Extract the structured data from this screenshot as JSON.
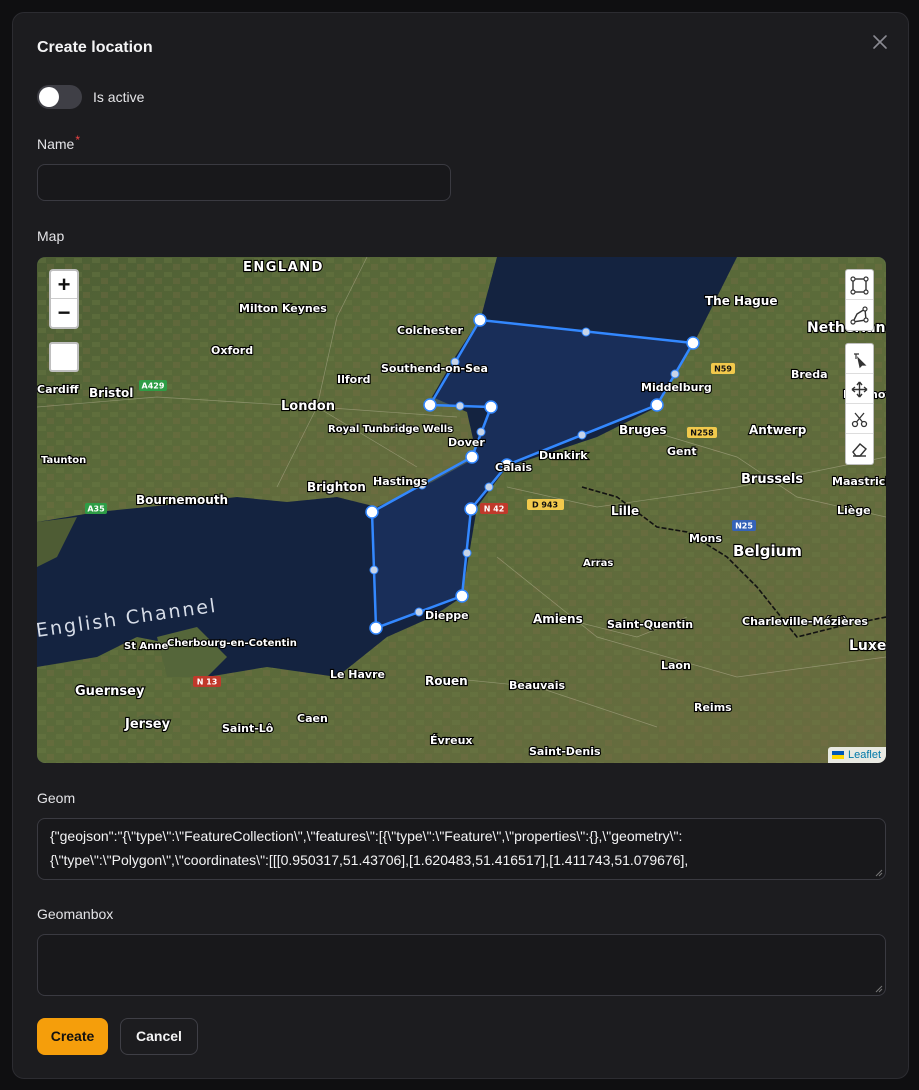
{
  "modal": {
    "title": "Create location",
    "toggle_label": "Is active",
    "toggle_on": false
  },
  "fields": {
    "name_label": "Name",
    "name_required_mark": "*",
    "name_value": "",
    "map_label": "Map",
    "geom_label": "Geom",
    "geom_value": "{\"geojson\":\"{\\\"type\\\":\\\"FeatureCollection\\\",\\\"features\\\":[{\\\"type\\\":\\\"Feature\\\",\\\"properties\\\":{},\\\"geometry\\\":{\\\"type\\\":\\\"Polygon\\\",\\\"coordinates\\\":[[[0.950317,51.43706],[1.620483,51.416517],[1.411743,51.079676],",
    "geomanbox_label": "Geomanbox",
    "geomanbox_value": ""
  },
  "map": {
    "zoom_in": "+",
    "zoom_out": "−",
    "attribution": "Leaflet",
    "places": [
      {
        "name": "ENGLAND",
        "cls": "region"
      },
      {
        "name": "Milton Keynes"
      },
      {
        "name": "Colchester"
      },
      {
        "name": "Oxford"
      },
      {
        "name": "Bristol"
      },
      {
        "name": "Cardiff"
      },
      {
        "name": "London"
      },
      {
        "name": "Southend-on-Sea"
      },
      {
        "name": "Ilford"
      },
      {
        "name": "Royal Tunbridge Wells"
      },
      {
        "name": "Dover"
      },
      {
        "name": "Taunton"
      },
      {
        "name": "Bournemouth"
      },
      {
        "name": "Brighton"
      },
      {
        "name": "Hastings"
      },
      {
        "name": "English Channel"
      },
      {
        "name": "St Anne"
      },
      {
        "name": "Cherbourg-en-Cotentin"
      },
      {
        "name": "Guernsey"
      },
      {
        "name": "Jersey"
      },
      {
        "name": "Le Havre"
      },
      {
        "name": "Saint-Lô"
      },
      {
        "name": "Caen"
      },
      {
        "name": "Rouen"
      },
      {
        "name": "Évreux"
      },
      {
        "name": "Dieppe"
      },
      {
        "name": "Amiens"
      },
      {
        "name": "Beauvais"
      },
      {
        "name": "Saint-Denis"
      },
      {
        "name": "Calais"
      },
      {
        "name": "Dunkirk"
      },
      {
        "name": "Bruges"
      },
      {
        "name": "Middelburg"
      },
      {
        "name": "The Hague"
      },
      {
        "name": "Netherlands"
      },
      {
        "name": "Breda"
      },
      {
        "name": "Antwerp"
      },
      {
        "name": "Gent"
      },
      {
        "name": "Brussels"
      },
      {
        "name": "Lille"
      },
      {
        "name": "Mons"
      },
      {
        "name": "Belgium"
      },
      {
        "name": "Arras"
      },
      {
        "name": "Saint-Quentin"
      },
      {
        "name": "Charleville-Mézières"
      },
      {
        "name": "Laon"
      },
      {
        "name": "Reims"
      },
      {
        "name": "Liège"
      },
      {
        "name": "Maastricht"
      },
      {
        "name": "Eindhoven"
      },
      {
        "name": "Luxembourg"
      }
    ],
    "shields": [
      "A429",
      "A35",
      "N 13",
      "N 42",
      "D 943",
      "N258",
      "N59",
      "N25"
    ]
  },
  "buttons": {
    "create": "Create",
    "cancel": "Cancel"
  },
  "colors": {
    "accent": "#f59e0b",
    "polygon_stroke": "#3388ff"
  }
}
